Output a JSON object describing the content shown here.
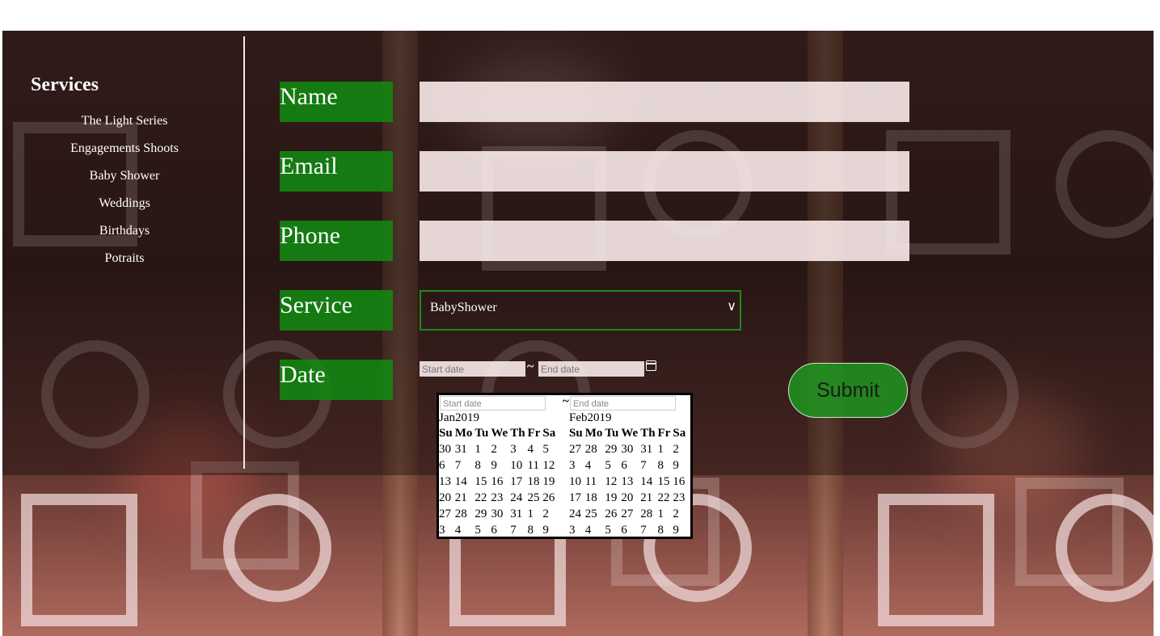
{
  "sidebar": {
    "title": "Services",
    "items": [
      "The Light Series",
      "Engagements Shoots",
      "Baby Shower",
      "Weddings",
      "Birthdays",
      "Potraits"
    ]
  },
  "form": {
    "name_label": "Name",
    "email_label": "Email",
    "phone_label": "Phone",
    "service_label": "Service",
    "date_label": "Date",
    "service_value": "BabyShower",
    "start_placeholder": "Start date",
    "end_placeholder": "End date",
    "range_separator": "~",
    "submit_label": "Submit"
  },
  "picker": {
    "start_placeholder": "Start date",
    "end_placeholder": "End date",
    "separator": "~",
    "weekdays": [
      "Su",
      "Mo",
      "Tu",
      "We",
      "Th",
      "Fr",
      "Sa"
    ],
    "months": [
      {
        "title": "Jan2019",
        "days": [
          "30",
          "31",
          "1",
          "2",
          "3",
          "4",
          "5",
          "6",
          "7",
          "8",
          "9",
          "10",
          "11",
          "12",
          "13",
          "14",
          "15",
          "16",
          "17",
          "18",
          "19",
          "20",
          "21",
          "22",
          "23",
          "24",
          "25",
          "26",
          "27",
          "28",
          "29",
          "30",
          "31",
          "1",
          "2",
          "3",
          "4",
          "5",
          "6",
          "7",
          "8",
          "9"
        ]
      },
      {
        "title": "Feb2019",
        "days": [
          "27",
          "28",
          "29",
          "30",
          "31",
          "1",
          "2",
          "3",
          "4",
          "5",
          "6",
          "7",
          "8",
          "9",
          "10",
          "11",
          "12",
          "13",
          "14",
          "15",
          "16",
          "17",
          "18",
          "19",
          "20",
          "21",
          "22",
          "23",
          "24",
          "25",
          "26",
          "27",
          "28",
          "1",
          "2",
          "3",
          "4",
          "5",
          "6",
          "7",
          "8",
          "9"
        ]
      }
    ]
  },
  "icons": {
    "dropdown": "chevron-down-icon",
    "calendar": "calendar-icon"
  },
  "colors": {
    "label_green": "#108c10",
    "submit_green": "#1e961e",
    "input_bg": "#fff0f0"
  }
}
